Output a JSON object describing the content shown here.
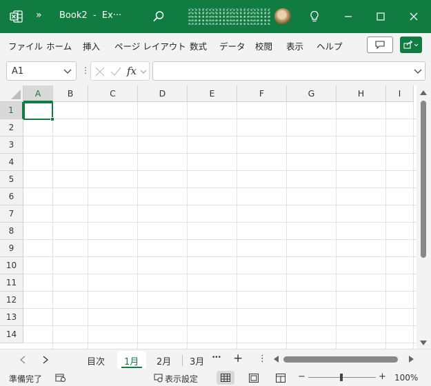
{
  "titlebar": {
    "app_icon": "excel-icon",
    "overflow_label": "»",
    "doc_name": "Book2",
    "doc_sep": "-",
    "doc_app": "Ex···",
    "icons": [
      "search-icon",
      "lightbulb-icon",
      "minimize-icon",
      "maximize-icon",
      "close-icon"
    ],
    "color": "#107c41"
  },
  "ribbon": {
    "tabs": [
      "ファイル",
      "ホーム",
      "挿入",
      "ページ レイアウト",
      "数式",
      "データ",
      "校閲",
      "表示",
      "ヘルプ"
    ]
  },
  "formula_bar": {
    "name_box": "A1",
    "fx_label": "fx",
    "formula_value": ""
  },
  "grid": {
    "columns": [
      "A",
      "B",
      "C",
      "D",
      "E",
      "F",
      "G",
      "H",
      "I"
    ],
    "rows": [
      "1",
      "2",
      "3",
      "4",
      "5",
      "6",
      "7",
      "8",
      "9",
      "10",
      "11",
      "12",
      "13",
      "14"
    ],
    "active_cell": "A1",
    "accent": "#107c41"
  },
  "sheets": {
    "tabs": [
      "目次",
      "1月",
      "2月",
      "3月"
    ],
    "active": "1月",
    "more_label": "•••",
    "add_label": "+",
    "menu_label": "⋮"
  },
  "status": {
    "ready": "準備完了",
    "display_settings": "表示設定",
    "zoom_minus": "−",
    "zoom_plus": "+",
    "zoom": "100%",
    "zoom_level": 100
  }
}
